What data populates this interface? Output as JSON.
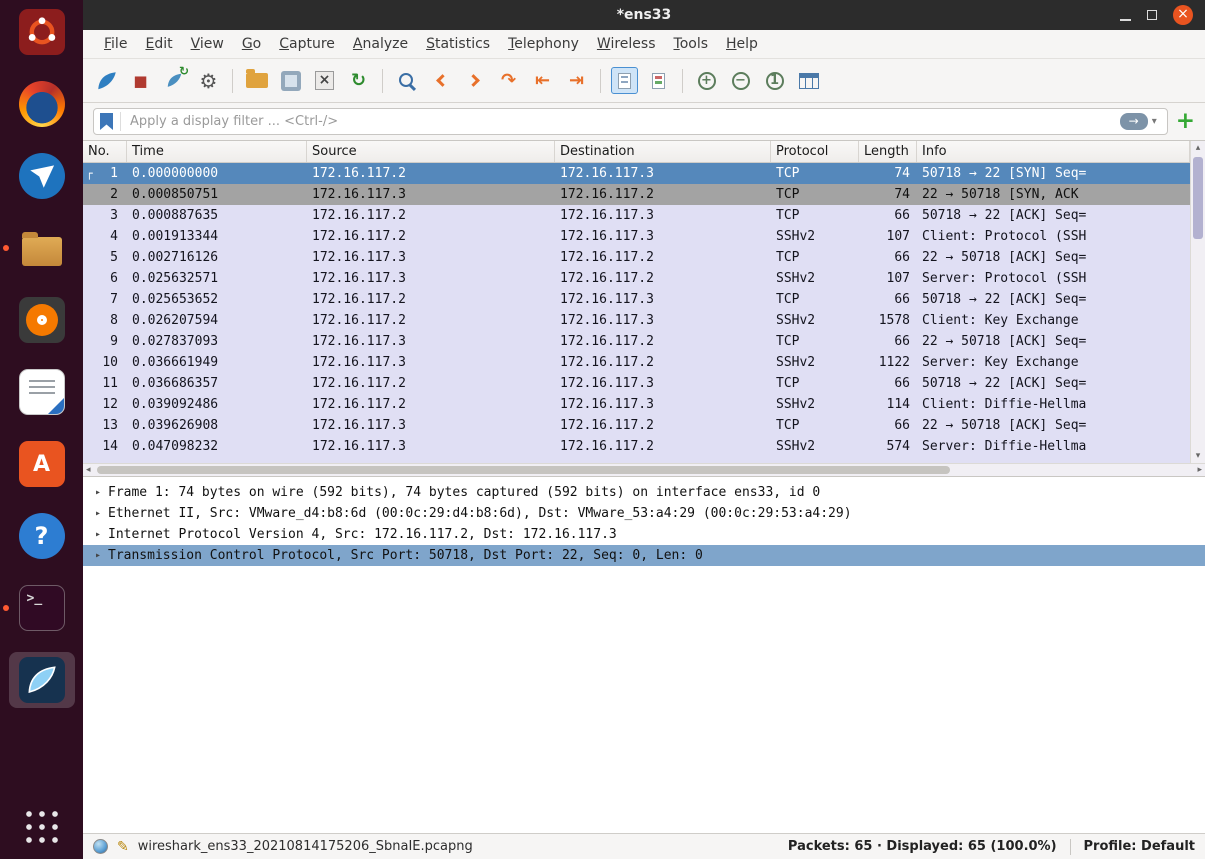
{
  "window": {
    "title": "*ens33",
    "close_glyph": "×"
  },
  "menu": {
    "items": [
      "File",
      "Edit",
      "View",
      "Go",
      "Capture",
      "Analyze",
      "Statistics",
      "Telephony",
      "Wireless",
      "Tools",
      "Help"
    ]
  },
  "toolbar": {
    "glyphs": {
      "stop": "■",
      "options": "⚙",
      "close_file": "×",
      "reload": "↻",
      "restart_arrow": "↻",
      "goto_packet": "↷",
      "first_packet": "⇤",
      "last_packet": "⇥",
      "zoom_in": "+",
      "zoom_out": "−",
      "zoom_orig": "1"
    }
  },
  "filter": {
    "placeholder": "Apply a display filter ... <Ctrl-/>",
    "apply_arrow": "→",
    "caret": "▾",
    "add": "+"
  },
  "packet_list": {
    "columns": [
      "No.",
      "Time",
      "Source",
      "Destination",
      "Protocol",
      "Length",
      "Info"
    ],
    "rows": [
      {
        "no": "1",
        "time": "0.000000000",
        "source": "172.16.117.2",
        "destination": "172.16.117.3",
        "protocol": "TCP",
        "length": "74",
        "info": "50718 → 22 [SYN] Seq=",
        "state": "selected",
        "marker": "┌"
      },
      {
        "no": "2",
        "time": "0.000850751",
        "source": "172.16.117.3",
        "destination": "172.16.117.2",
        "protocol": "TCP",
        "length": "74",
        "info": "22 → 50718 [SYN, ACK",
        "state": "gray"
      },
      {
        "no": "3",
        "time": "0.000887635",
        "source": "172.16.117.2",
        "destination": "172.16.117.3",
        "protocol": "TCP",
        "length": "66",
        "info": "50718 → 22 [ACK] Seq=",
        "state": "normal"
      },
      {
        "no": "4",
        "time": "0.001913344",
        "source": "172.16.117.2",
        "destination": "172.16.117.3",
        "protocol": "SSHv2",
        "length": "107",
        "info": "Client: Protocol (SSH",
        "state": "normal"
      },
      {
        "no": "5",
        "time": "0.002716126",
        "source": "172.16.117.3",
        "destination": "172.16.117.2",
        "protocol": "TCP",
        "length": "66",
        "info": "22 → 50718 [ACK] Seq=",
        "state": "normal"
      },
      {
        "no": "6",
        "time": "0.025632571",
        "source": "172.16.117.3",
        "destination": "172.16.117.2",
        "protocol": "SSHv2",
        "length": "107",
        "info": "Server: Protocol (SSH",
        "state": "normal"
      },
      {
        "no": "7",
        "time": "0.025653652",
        "source": "172.16.117.2",
        "destination": "172.16.117.3",
        "protocol": "TCP",
        "length": "66",
        "info": "50718 → 22 [ACK] Seq=",
        "state": "normal"
      },
      {
        "no": "8",
        "time": "0.026207594",
        "source": "172.16.117.2",
        "destination": "172.16.117.3",
        "protocol": "SSHv2",
        "length": "1578",
        "info": "Client: Key Exchange",
        "state": "normal"
      },
      {
        "no": "9",
        "time": "0.027837093",
        "source": "172.16.117.3",
        "destination": "172.16.117.2",
        "protocol": "TCP",
        "length": "66",
        "info": "22 → 50718 [ACK] Seq=",
        "state": "normal"
      },
      {
        "no": "10",
        "time": "0.036661949",
        "source": "172.16.117.3",
        "destination": "172.16.117.2",
        "protocol": "SSHv2",
        "length": "1122",
        "info": "Server: Key Exchange",
        "state": "normal"
      },
      {
        "no": "11",
        "time": "0.036686357",
        "source": "172.16.117.2",
        "destination": "172.16.117.3",
        "protocol": "TCP",
        "length": "66",
        "info": "50718 → 22 [ACK] Seq=",
        "state": "normal"
      },
      {
        "no": "12",
        "time": "0.039092486",
        "source": "172.16.117.2",
        "destination": "172.16.117.3",
        "protocol": "SSHv2",
        "length": "114",
        "info": "Client: Diffie-Hellma",
        "state": "normal"
      },
      {
        "no": "13",
        "time": "0.039626908",
        "source": "172.16.117.3",
        "destination": "172.16.117.2",
        "protocol": "TCP",
        "length": "66",
        "info": "22 → 50718 [ACK] Seq=",
        "state": "normal"
      },
      {
        "no": "14",
        "time": "0.047098232",
        "source": "172.16.117.3",
        "destination": "172.16.117.2",
        "protocol": "SSHv2",
        "length": "574",
        "info": "Server: Diffie-Hellma",
        "state": "normal"
      },
      {
        "no": "",
        "time": "",
        "source": "",
        "destination": "",
        "protocol": "",
        "length": "",
        "info": "",
        "state": "partial"
      }
    ]
  },
  "details": {
    "expander": "▸",
    "lines": [
      {
        "text": "Frame 1: 74 bytes on wire (592 bits), 74 bytes captured (592 bits) on interface ens33, id 0",
        "selected": false
      },
      {
        "text": "Ethernet II, Src: VMware_d4:b8:6d (00:0c:29:d4:b8:6d), Dst: VMware_53:a4:29 (00:0c:29:53:a4:29)",
        "selected": false
      },
      {
        "text": "Internet Protocol Version 4, Src: 172.16.117.2, Dst: 172.16.117.3",
        "selected": false
      },
      {
        "text": "Transmission Control Protocol, Src Port: 50718, Dst Port: 22, Seq: 0, Len: 0",
        "selected": true
      }
    ]
  },
  "dock": {
    "terminal_glyph": ">_",
    "help_glyph": "?",
    "software_glyph": "A"
  },
  "status": {
    "filename": "wireshark_ens33_20210814175206_SbnaIE.pcapng",
    "packets": "Packets: 65 · Displayed: 65 (100.0%)",
    "profile": "Profile: Default"
  },
  "icons": {
    "up": "▴",
    "down": "▾",
    "left": "◂",
    "right": "▸",
    "pencil": "✎"
  },
  "colors": {
    "selection_blue": "#5588bb",
    "row_lavender": "#e0dff4",
    "row_gray": "#a3a3a3",
    "detail_selection": "#7fa5cb",
    "close_button_orange": "#e95420",
    "dock_background": "#2e0d20",
    "titlebar": "#2c2c2c",
    "accent_orange": "#e8702a",
    "filter_add_green": "#35a835"
  }
}
